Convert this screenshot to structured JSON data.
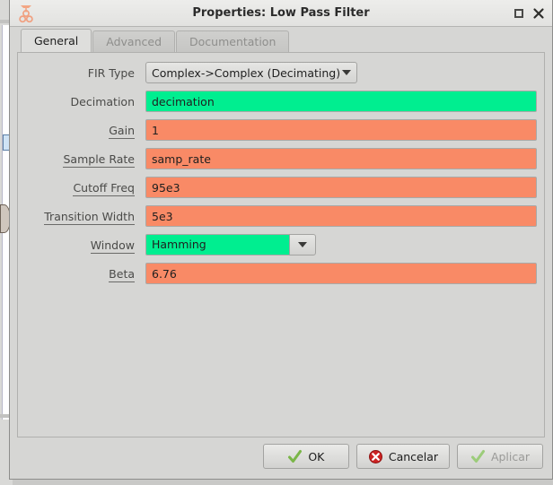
{
  "window": {
    "title": "Properties: Low Pass Filter",
    "app_icon": "gnuradio-logo-icon",
    "controls": [
      {
        "name": "maximize-button",
        "icon": "maximize-icon",
        "glyph": "□"
      },
      {
        "name": "close-button",
        "icon": "close-icon",
        "glyph": "✕"
      }
    ]
  },
  "tabs": [
    {
      "label": "General",
      "active": true
    },
    {
      "label": "Advanced",
      "active": false
    },
    {
      "label": "Documentation",
      "active": false
    }
  ],
  "form": {
    "rows": [
      {
        "label": "FIR Type",
        "underlined": false,
        "widget": "combo-plain",
        "value": "Complex->Complex (Decimating)",
        "state": "default"
      },
      {
        "label": "Decimation",
        "underlined": false,
        "widget": "text",
        "value": "decimation",
        "state": "green"
      },
      {
        "label": "Gain",
        "underlined": true,
        "widget": "text",
        "value": "1",
        "state": "orange"
      },
      {
        "label": "Sample Rate",
        "underlined": true,
        "widget": "text",
        "value": "samp_rate",
        "state": "orange"
      },
      {
        "label": "Cutoff Freq",
        "underlined": true,
        "widget": "text",
        "value": "95e3",
        "state": "orange"
      },
      {
        "label": "Transition Width",
        "underlined": true,
        "widget": "text",
        "value": "5e3",
        "state": "orange"
      },
      {
        "label": "Window",
        "underlined": true,
        "widget": "combo-split",
        "value": "Hamming",
        "state": "green"
      },
      {
        "label": "Beta",
        "underlined": true,
        "widget": "text",
        "value": "6.76",
        "state": "orange"
      }
    ]
  },
  "buttons": [
    {
      "label": "OK",
      "icon": "check-icon",
      "disabled": false
    },
    {
      "label": "Cancelar",
      "icon": "error-x-icon",
      "disabled": false
    },
    {
      "label": "Aplicar",
      "icon": "check-icon",
      "disabled": true
    }
  ],
  "colors": {
    "valid_field": "#00ee90",
    "invalid_field": "#f98a66",
    "window_bg": "#d6d6d4",
    "titlebar_bg": "#e8e8e6",
    "accent_icon": "#f0a080"
  }
}
